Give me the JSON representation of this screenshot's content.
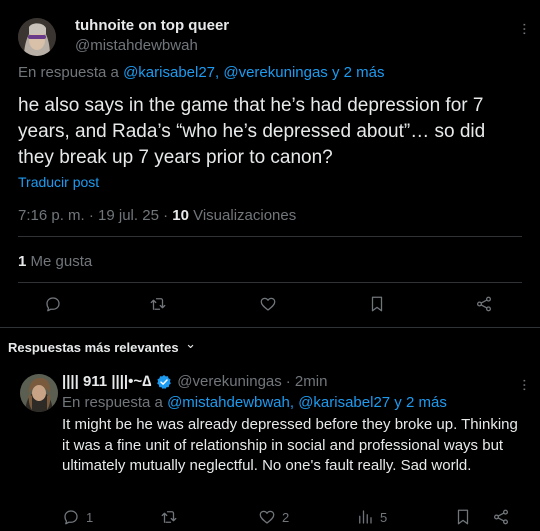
{
  "main_post": {
    "display_name": "tuhnoite on top queer",
    "handle": "@mistahdewbwah",
    "reply_prefix": "En respuesta a",
    "reply_targets": "@karisabel27, @verekuningas y 2 más",
    "body": "he also says in the game that he’s had depression for 7 years, and Rada’s “who he’s depressed about”… so did they break up 7 years prior to canon?",
    "translate": "Traducir post",
    "timestamp": "7:16 p. m. · 19 jul. 25 ·",
    "views_count": "10",
    "views_label": "Visualizaciones",
    "likes_count": "1",
    "likes_label": "Me gusta"
  },
  "replies_header": {
    "label": "Respuestas más relevantes",
    "chevron": "⌄"
  },
  "reply": {
    "display_name": "|||| 911 ||||•~∆",
    "handle": "@verekuningas",
    "time": "· 2min",
    "reply_prefix": "En respuesta a",
    "reply_targets": "@mistahdewbwah, @karisabel27 y 2 más",
    "body": "It might be he was already depressed before they broke up. Thinking it was a fine unit of relationship in social and professional ways but ultimately mutually neglectful. No one's fault really. Sad world.",
    "reply_count": "1",
    "like_count": "2",
    "view_count": "5"
  },
  "colors": {
    "background": "#000000",
    "text": "#e7e9ea",
    "muted": "#71767b",
    "link": "#1d9bf0",
    "divider": "#2f3336",
    "verified": "#1d9bf0"
  },
  "icons": [
    "more-icon",
    "reply-icon",
    "retweet-icon",
    "like-icon",
    "bookmark-icon",
    "share-icon",
    "views-icon",
    "verified-badge-icon",
    "chevron-down-icon"
  ]
}
